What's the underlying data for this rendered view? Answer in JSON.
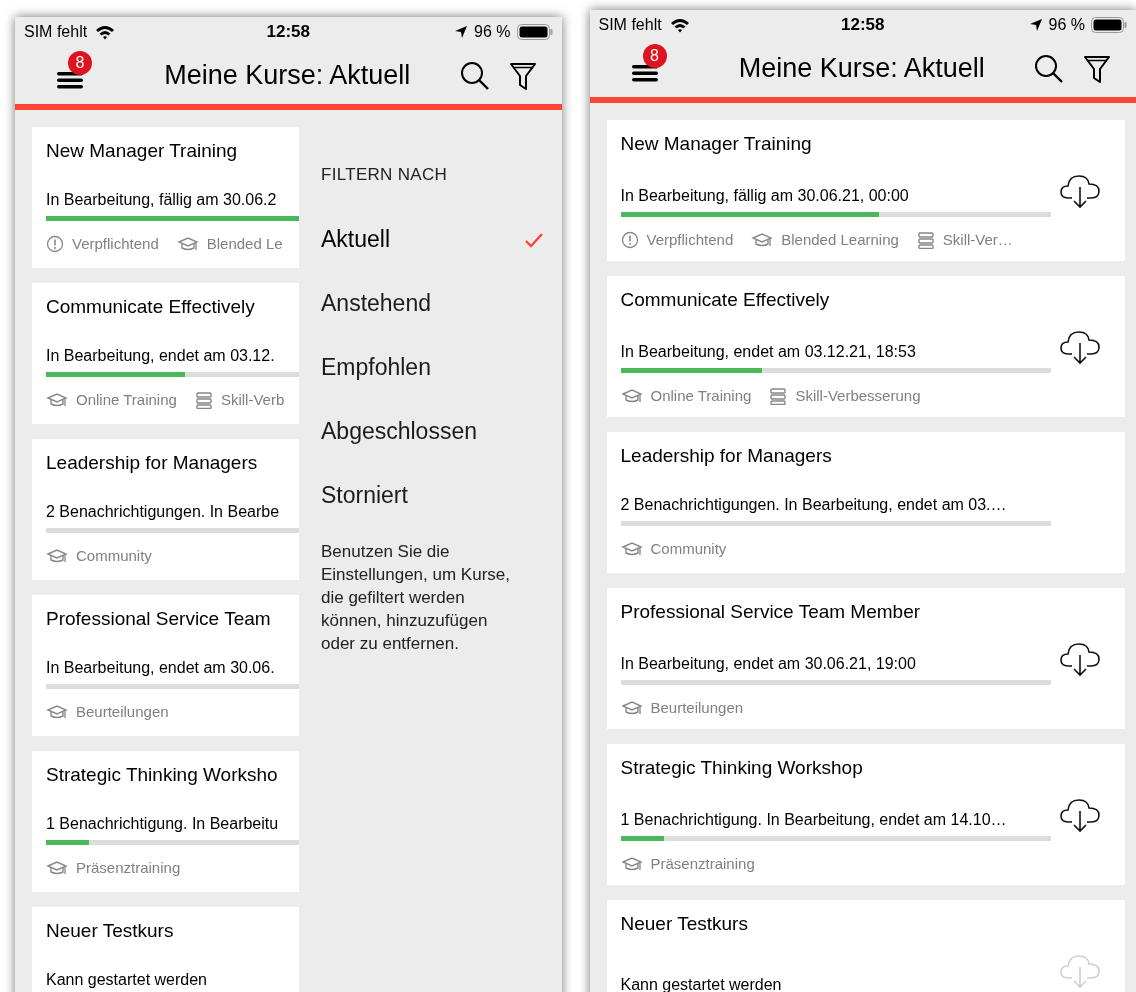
{
  "screens": [
    {
      "status_bar": {
        "carrier": "SIM fehlt",
        "time": "12:58",
        "battery": "96 %"
      },
      "header": {
        "title": "Meine Kurse: Aktuell",
        "badge": "8"
      },
      "courses": [
        {
          "title": "New Manager Training",
          "status": "In Bearbeitung, fällig am 30.06.2",
          "level": 1,
          "tags": [
            {
              "kind": "required",
              "label": "Verpflichtend"
            },
            {
              "kind": "course",
              "label": "Blended Le"
            }
          ]
        },
        {
          "title": "Communicate Effectively",
          "status": "In Bearbeitung, endet am 03.12.",
          "level": 0.55,
          "tags": [
            {
              "kind": "course",
              "label": "Online Training"
            },
            {
              "kind": "skill",
              "label": "Skill-Verb"
            }
          ]
        },
        {
          "title": "Leadership for Managers",
          "status": "2 Benachrichtigungen. In Bearbe",
          "level": 0,
          "tags": [
            {
              "kind": "course",
              "label": "Community"
            }
          ]
        },
        {
          "title": "Professional Service Team",
          "status": "In Bearbeitung, endet am 30.06.",
          "level": 0,
          "tags": [
            {
              "kind": "course",
              "label": "Beurteilungen"
            }
          ]
        },
        {
          "title": "Strategic Thinking Worksho",
          "status": "1 Benachrichtigung. In Bearbeitu",
          "level": 0.17,
          "tags": [
            {
              "kind": "course",
              "label": "Präsenztraining"
            }
          ]
        },
        {
          "title": "Neuer Testkurs",
          "status": "Kann gestartet werden"
        }
      ],
      "filter_panel": {
        "heading": "FILTERN NACH",
        "options": [
          {
            "label": "Aktuell",
            "selected": true
          },
          {
            "label": "Anstehend",
            "selected": false
          },
          {
            "label": "Empfohlen",
            "selected": false
          },
          {
            "label": "Abgeschlossen",
            "selected": false
          },
          {
            "label": "Storniert",
            "selected": false
          }
        ],
        "note": "Benutzen Sie die Einstellungen, um Kurse, die gefiltert werden können, hinzuzufügen oder zu entfernen."
      }
    },
    {
      "status_bar": {
        "carrier": "SIM fehlt",
        "time": "12:58",
        "battery": "96 %"
      },
      "header": {
        "title": "Meine Kurse: Aktuell",
        "badge": "8"
      },
      "courses": [
        {
          "title": "New Manager Training",
          "status": "In Bearbeitung, fällig am 30.06.21, 00:00",
          "level": 0.6,
          "download_enabled": true,
          "tags": [
            {
              "kind": "required",
              "label": "Verpflichtend"
            },
            {
              "kind": "course",
              "label": "Blended Learning"
            },
            {
              "kind": "skill",
              "label": "Skill-Ver…"
            }
          ]
        },
        {
          "title": "Communicate Effectively",
          "status": "In Bearbeitung, endet am 03.12.21, 18:53",
          "level": 0.33,
          "download_enabled": true,
          "tags": [
            {
              "kind": "course",
              "label": "Online Training"
            },
            {
              "kind": "skill",
              "label": "Skill-Verbesserung"
            }
          ]
        },
        {
          "title": "Leadership for Managers",
          "status": "2 Benachrichtigungen. In Bearbeitung, endet am 03.…",
          "level": 0,
          "tags": [
            {
              "kind": "course",
              "label": "Community"
            }
          ]
        },
        {
          "title": "Professional Service Team Member",
          "status": "In Bearbeitung, endet am 30.06.21, 19:00",
          "level": 0,
          "download_enabled": true,
          "tags": [
            {
              "kind": "course",
              "label": "Beurteilungen"
            }
          ]
        },
        {
          "title": "Strategic Thinking Workshop",
          "status": "1 Benachrichtigung. In Bearbeitung, endet am 14.10…",
          "level": 0.1,
          "download_enabled": true,
          "tags": [
            {
              "kind": "course",
              "label": "Präsenztraining"
            }
          ]
        },
        {
          "title": "Neuer Testkurs",
          "status": "Kann gestartet werden",
          "download_enabled": false
        }
      ]
    }
  ]
}
